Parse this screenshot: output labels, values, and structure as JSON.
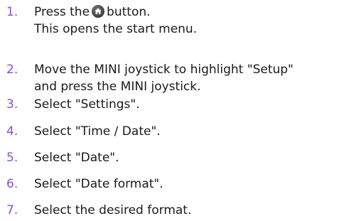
{
  "steps": [
    {
      "number": "1.",
      "line1_before": "Press the",
      "button_icon": "home-button-icon",
      "line1_after": "button.",
      "line2": "This opens the start menu."
    },
    {
      "number": "2.",
      "line1": "Move the MINI joystick to highlight \"Setup\"",
      "line2": "and press the MINI joystick."
    },
    {
      "number": "3.",
      "line1": "Select \"Settings\"."
    },
    {
      "number": "4.",
      "line1": "Select \"Time / Date\"."
    },
    {
      "number": "5.",
      "line1": "Select \"Date\"."
    },
    {
      "number": "6.",
      "line1": "Select \"Date format\"."
    },
    {
      "number": "7.",
      "line1": "Select the desired format."
    }
  ],
  "colors": {
    "number": "#8b4fc9",
    "text": "#1a1a1a"
  }
}
